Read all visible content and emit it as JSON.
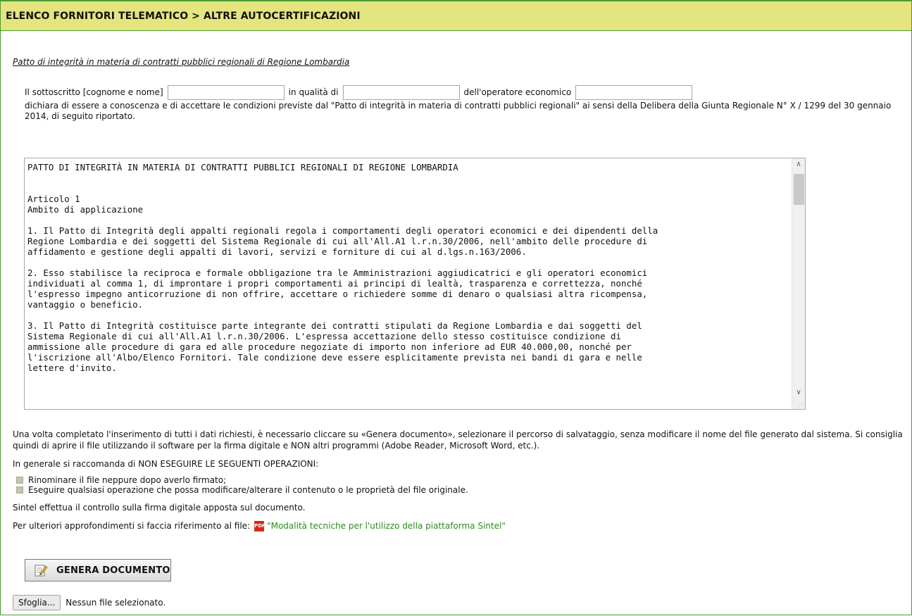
{
  "header": {
    "title": "ELENCO FORNITORI TELEMATICO  > ALTRE AUTOCERTIFICAZIONI"
  },
  "section_title": "Patto di integrità in materia di contratti pubblici regionali di Regione Lombardia",
  "declaration": {
    "label_name": "Il sottoscritto [cognome e nome]",
    "name_value": "",
    "label_role": "in qualità di",
    "role_value": "",
    "label_operator": "dell'operatore economico",
    "operator_value": "",
    "text": "dichiara di essere a conoscenza e di accettare le condizioni previste dal \"Patto di integrità in materia di contratti pubblici regionali\" ai sensi della Delibera della Giunta Regionale N° X / 1299 del 30 gennaio 2014, di seguito riportato."
  },
  "document_text": "PATTO DI INTEGRITÀ IN MATERIA DI CONTRATTI PUBBLICI REGIONALI DI REGIONE LOMBARDIA\n\n\nArticolo 1\nAmbito di applicazione\n\n1. Il Patto di Integrità degli appalti regionali regola i comportamenti degli operatori economici e dei dipendenti della\nRegione Lombardia e dei soggetti del Sistema Regionale di cui all'All.A1 l.r.n.30/2006, nell'ambito delle procedure di\naffidamento e gestione degli appalti di lavori, servizi e forniture di cui al d.lgs.n.163/2006.\n\n2. Esso stabilisce la reciproca e formale obbligazione tra le Amministrazioni aggiudicatrici e gli operatori economici\nindividuati al comma 1, di improntare i propri comportamenti ai principi di lealtà, trasparenza e correttezza, nonché\nl'espresso impegno anticorruzione di non offrire, accettare o richiedere somme di denaro o qualsiasi altra ricompensa,\nvantaggio o beneficio.\n\n3. Il Patto di Integrità costituisce parte integrante dei contratti stipulati da Regione Lombardia e dai soggetti del\nSistema Regionale di cui all'All.A1 l.r.n.30/2006. L'espressa accettazione dello stesso costituisce condizione di\nammissione alle procedure di gara ed alle procedure negoziate di importo non inferiore ad EUR 40.000,00, nonché per\nl'iscrizione all'Albo/Elenco Fornitori. Tale condizione deve essere esplicitamente prevista nei bandi di gara e nelle\nlettere d'invito.",
  "instructions": {
    "p1": "Una volta completato l'inserimento di tutti i dati richiesti, è necessario cliccare su «Genera documento», selezionare il percorso di salvataggio, senza modificare il nome del file generato dal sistema. Si consiglia quindi di aprire il file utilizzando il software per la firma digitale e NON altri programmi (Adobe Reader, Microsoft Word, etc.).",
    "p2": "In generale si raccomanda di NON ESEGUIRE LE SEGUENTI OPERAZIONI:",
    "bullets": [
      "Rinominare il file neppure dopo averlo firmato;",
      "Eseguire qualsiasi operazione che possa modificare/alterare il contenuto o le proprietà del file originale."
    ],
    "p3": "Sintel effettua il controllo sulla firma digitale apposta sul documento.",
    "p4": "Per ulteriori approfondimenti si faccia riferimento al file:",
    "file_link": "\"Modalità tecniche per l'utilizzo della piattaforma Sintel\"",
    "pdf_icon_label": "PDF"
  },
  "buttons": {
    "generate": "GENERA DOCUMENTO",
    "browse": "Sfoglia...",
    "no_file": "Nessun file selezionato."
  },
  "colors": {
    "header_bg": "#e5e57f",
    "border": "#4b9a34",
    "link": "#2e8b1f"
  }
}
